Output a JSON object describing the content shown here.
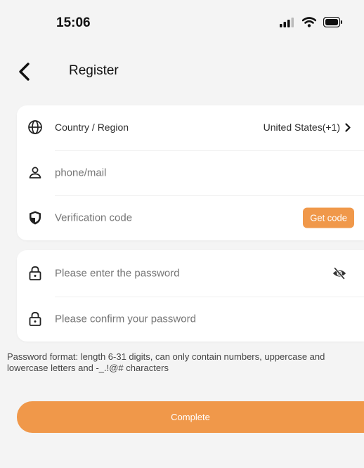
{
  "status": {
    "time": "15:06"
  },
  "header": {
    "title": "Register"
  },
  "form": {
    "country_label": "Country / Region",
    "country_value": "United States(+1)",
    "phone_placeholder": "phone/mail",
    "code_placeholder": "Verification code",
    "get_code_label": "Get code",
    "password_placeholder": "Please enter the password",
    "confirm_placeholder": "Please confirm your password"
  },
  "hint": "Password format: length 6-31 digits, can only contain numbers, uppercase and lowercase letters and -_.!@# characters",
  "complete_label": "Complete",
  "colors": {
    "accent": "#f0984a",
    "background": "#f4f4f4"
  }
}
